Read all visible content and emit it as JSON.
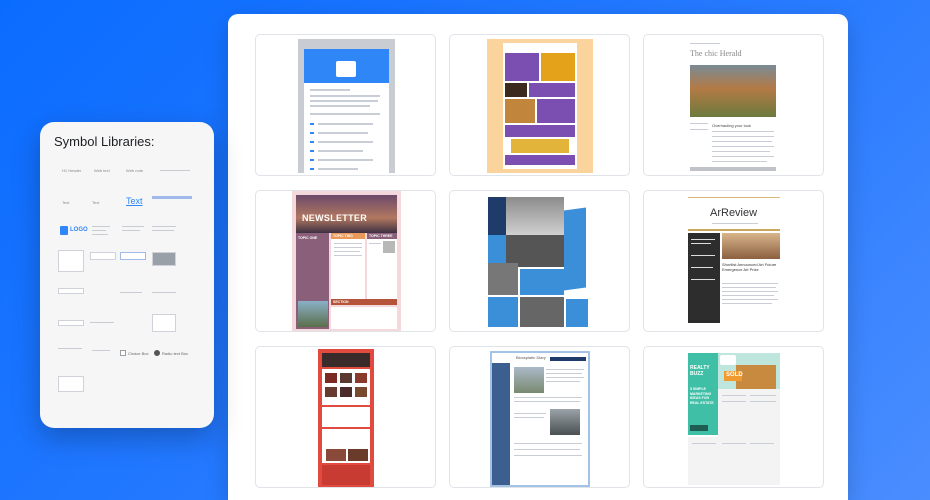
{
  "symbol_panel": {
    "title": "Symbol Libraries:",
    "items": {
      "h1": "H1 Header",
      "web_text": "Web text",
      "web_note": "Web note",
      "text1": "Text",
      "text2": "Text",
      "text_big": "Text",
      "logo": "LOGO",
      "choice_box": "Choice Box",
      "radio_label": "Radio text Box"
    }
  },
  "templates": [
    {
      "name": "email-calendar-template"
    },
    {
      "name": "photo-collage-template"
    },
    {
      "name": "chic-herald-template",
      "title": "The chic Herald",
      "headline": "Overhauling your look"
    },
    {
      "name": "newsletter-template",
      "title": "NEWSLETTER",
      "col1": "TOPIC ONE",
      "col2": "TOPIC TWO",
      "col3": "TOPIC THREE",
      "section": "SECTION"
    },
    {
      "name": "architecture-template"
    },
    {
      "name": "arreview-template",
      "title": "ArReview",
      "headline": "Shortlist Announced Art Future Emergence Art Prize"
    },
    {
      "name": "red-events-template"
    },
    {
      "name": "blue-journal-template",
      "title": "Bloxsplatin Diary"
    },
    {
      "name": "realty-buzz-template",
      "title": "REALTY BUZZ",
      "sub": "5 SIMPLE MARKETING IDEAS FOR REAL ESTATE",
      "badge": "SOLD"
    }
  ]
}
